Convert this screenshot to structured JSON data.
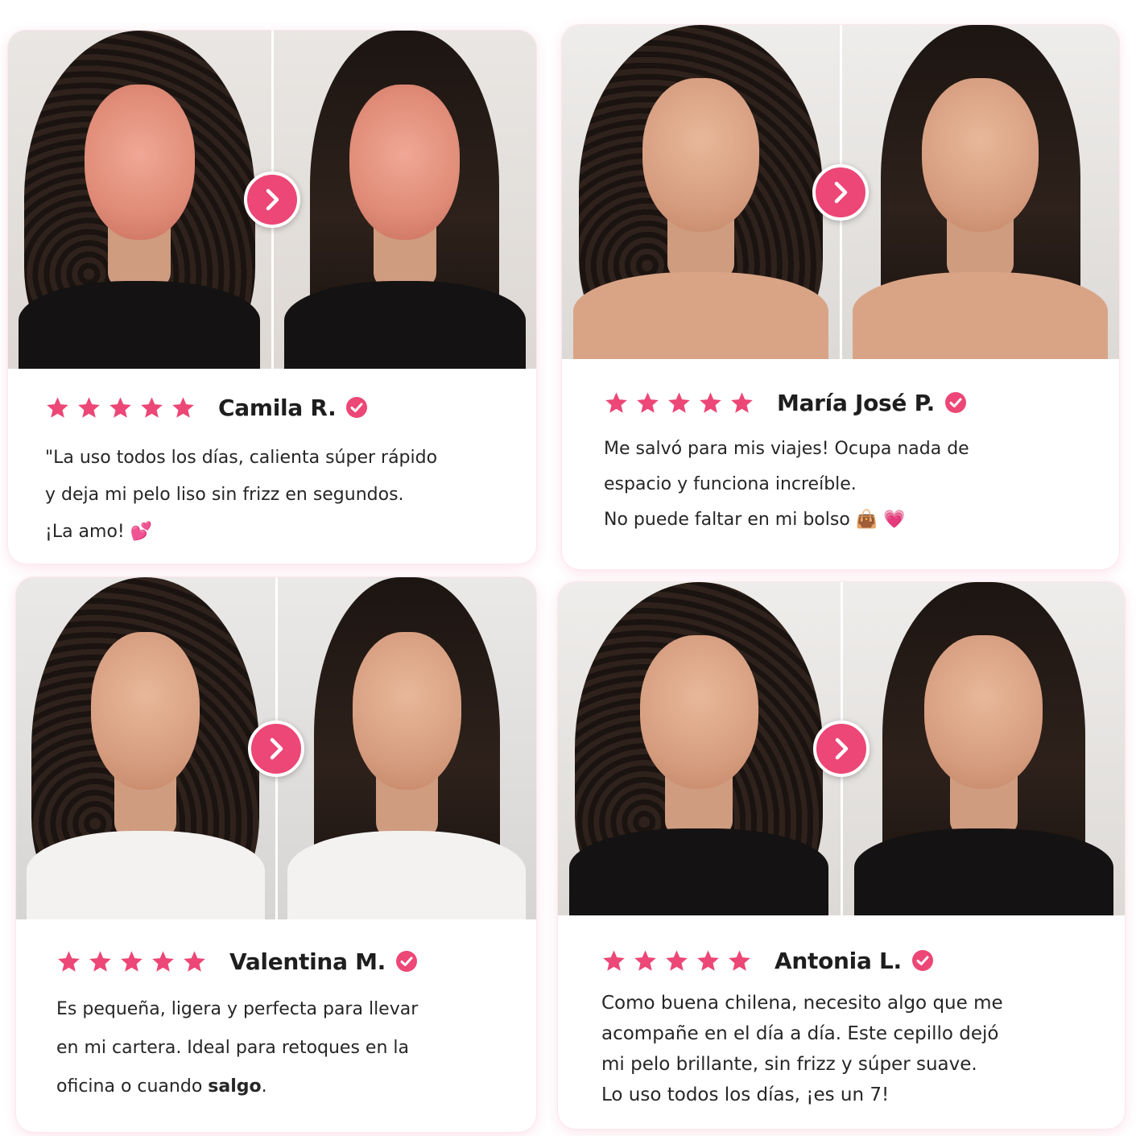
{
  "theme": {
    "accent": "#ec4776",
    "text": "#262626",
    "card_bg": "#ffffff"
  },
  "reviews": [
    {
      "name": "Camila R.",
      "rating": 5,
      "verified": true,
      "lines": [
        "\"La uso todos los días, calienta súper rápido",
        "y deja mi pelo liso sin frizz en segundos.",
        "¡La amo! 💕"
      ]
    },
    {
      "name": "María José P.",
      "rating": 5,
      "verified": true,
      "lines": [
        "Me salvó para mis viajes! Ocupa nada de",
        "espacio y funciona increíble.",
        "No puede faltar en mi bolso 👜 💗"
      ]
    },
    {
      "name": "Valentina M.",
      "rating": 5,
      "verified": true,
      "lines": [
        "Es pequeña, ligera y perfecta para llevar",
        "en mi cartera. Ideal para retoques en la",
        "oficina o cuando "
      ],
      "bold_tail": "salgo",
      "tail_after": "."
    },
    {
      "name": "Antonia L.",
      "rating": 5,
      "verified": true,
      "lines": [
        "Como buena chilena, necesito algo que me",
        "acompañe en el día a día. Este cepillo dejó",
        "mi pelo brillante, sin frizz y súper suave.",
        "Lo uso todos los días, ¡es un 7!"
      ]
    }
  ],
  "icons": {
    "star": "star-icon",
    "verified": "verified-check-icon",
    "arrow": "chevron-right-icon"
  }
}
